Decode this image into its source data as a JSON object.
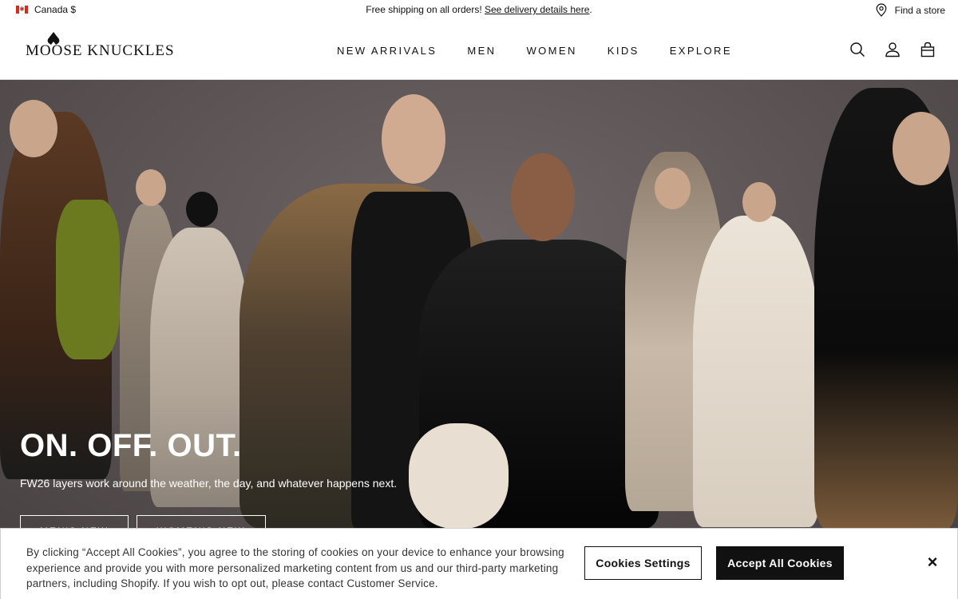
{
  "topbar": {
    "country": "Canada $",
    "flag_glyph": "✱",
    "promo_text": "Free shipping on all orders! ",
    "promo_link": "See delivery details here",
    "promo_end": ".",
    "store_label": "Find a store"
  },
  "header": {
    "logo_text": "MOOSE KNUCKLES",
    "nav": [
      "NEW ARRIVALS",
      "MEN",
      "WOMEN",
      "KIDS",
      "EXPLORE"
    ],
    "icons": [
      "search-icon",
      "account-icon",
      "bag-icon"
    ]
  },
  "hero": {
    "title": "ON. OFF. OUT.",
    "subtitle": "FW26 layers work around the weather, the day, and whatever happens next.",
    "buttons": [
      "MEN'S NEW",
      "WOMEN'S NEW"
    ]
  },
  "cookie": {
    "text": "By clicking “Accept All Cookies”, you agree to the storing of cookies on your device to enhance your browsing experience and provide you with more personalized marketing content from us and our third-party marketing partners, including Shopify. If you wish to opt out, please contact Customer Service.",
    "settings_label": "Cookies Settings",
    "accept_label": "Accept All Cookies",
    "close_glyph": "×"
  },
  "colors": {
    "hero_bg": "#5a5253",
    "accent": "#111111",
    "flag_red": "#d52b1e"
  }
}
